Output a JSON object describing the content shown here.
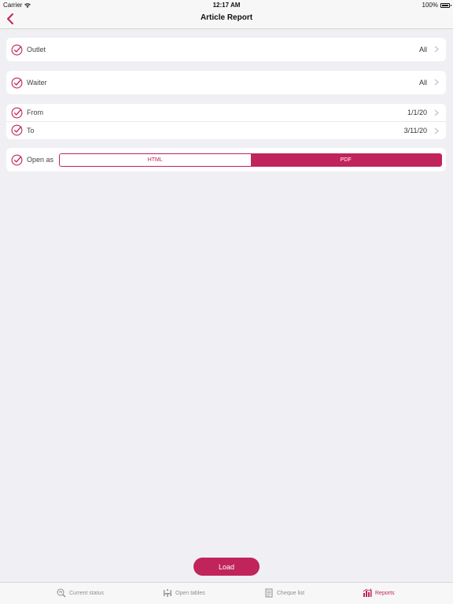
{
  "status_bar": {
    "carrier": "Carrier",
    "time": "12:17 AM",
    "battery": "100%"
  },
  "nav": {
    "title": "Article Report",
    "back_icon": "chevron-left-icon"
  },
  "rows": {
    "outlet": {
      "label": "Outlet",
      "value": "All"
    },
    "waiter": {
      "label": "Waiter",
      "value": "All"
    },
    "from": {
      "label": "From",
      "value": "1/1/20"
    },
    "to": {
      "label": "To",
      "value": "3/11/20"
    },
    "open_as": {
      "label": "Open as",
      "options": [
        "HTML",
        "PDF"
      ],
      "selected": "PDF"
    }
  },
  "load_button": {
    "label": "Load"
  },
  "tabs": [
    {
      "label": "Current status",
      "icon": "current-status-icon"
    },
    {
      "label": "Open tables",
      "icon": "open-tables-icon"
    },
    {
      "label": "Cheque list",
      "icon": "cheque-list-icon"
    },
    {
      "label": "Reports",
      "icon": "reports-icon",
      "active": true
    }
  ],
  "colors": {
    "accent": "#c0245a",
    "background": "#efeff4",
    "inactive": "#8e8e93"
  }
}
